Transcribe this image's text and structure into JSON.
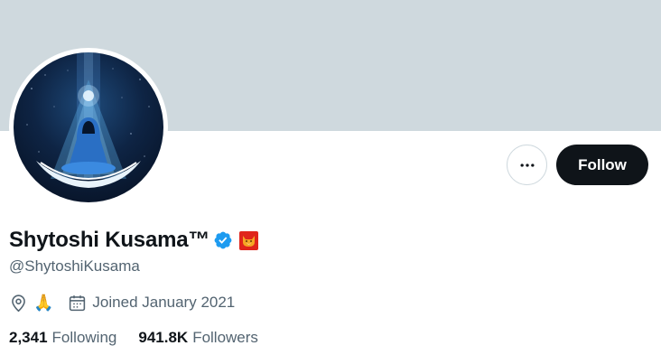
{
  "profile": {
    "display_name": "Shytoshi Kusama™",
    "handle": "@ShytoshiKusama",
    "location_emoji": "🙏",
    "joined": "Joined January 2021"
  },
  "actions": {
    "follow_label": "Follow"
  },
  "stats": {
    "following_count": "2,341",
    "following_label": "Following",
    "followers_count": "941.8K",
    "followers_label": "Followers"
  },
  "colors": {
    "banner": "#cfd9de",
    "verified": "#1d9bf0",
    "follow_button": "#0f1419",
    "muted_text": "#536471"
  },
  "icons": {
    "more": "more-dots-icon",
    "verified": "verified-badge-icon",
    "affiliate": "shib-affiliate-badge-icon",
    "location": "location-pin-icon",
    "calendar": "calendar-icon"
  }
}
